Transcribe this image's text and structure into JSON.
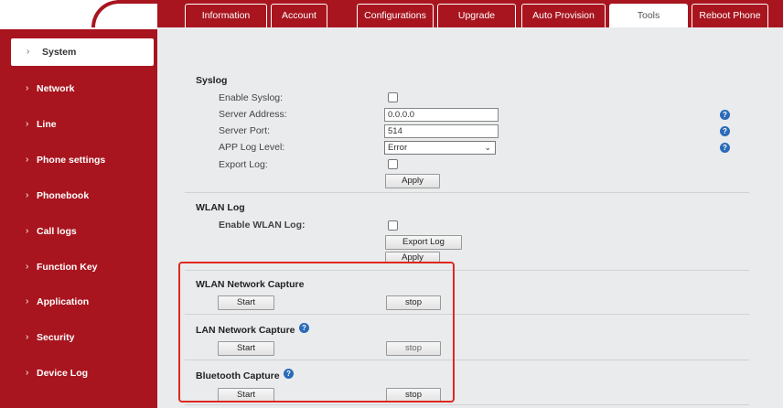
{
  "tabs": [
    {
      "label": "Information",
      "active": false
    },
    {
      "label": "Account",
      "active": false
    },
    {
      "label": "Configurations",
      "active": false
    },
    {
      "label": "Upgrade",
      "active": false
    },
    {
      "label": "Auto Provision",
      "active": false
    },
    {
      "label": "Tools",
      "active": true
    },
    {
      "label": "Reboot Phone",
      "active": false
    }
  ],
  "sidebar": {
    "chevron": "›",
    "items": [
      {
        "label": "System",
        "active": true
      },
      {
        "label": "Network"
      },
      {
        "label": "Line"
      },
      {
        "label": "Phone settings"
      },
      {
        "label": "Phonebook"
      },
      {
        "label": "Call logs"
      },
      {
        "label": "Function Key"
      },
      {
        "label": "Application"
      },
      {
        "label": "Security"
      },
      {
        "label": "Device Log"
      }
    ]
  },
  "syslog": {
    "title": "Syslog",
    "enable_label": "Enable Syslog:",
    "server_address_label": "Server Address:",
    "server_address_value": "0.0.0.0",
    "server_port_label": "Server Port:",
    "server_port_value": "514",
    "app_log_level_label": "APP Log Level:",
    "app_log_level_value": "Error",
    "export_log_label": "Export Log:",
    "apply_label": "Apply",
    "help_glyph": "?"
  },
  "wlan_log": {
    "title": "WLAN Log",
    "enable_label": "Enable WLAN Log:",
    "export_label": "Export Log",
    "apply_label": "Apply"
  },
  "captures": {
    "wlan_title": "WLAN Network Capture",
    "lan_title": "LAN Network Capture",
    "bt_title": "Bluetooth Capture",
    "start_label": "Start",
    "stop_label": "stop"
  },
  "colors": {
    "brand_red": "#a8151f",
    "help_blue": "#2a6ab8",
    "highlight": "#e0281f"
  }
}
